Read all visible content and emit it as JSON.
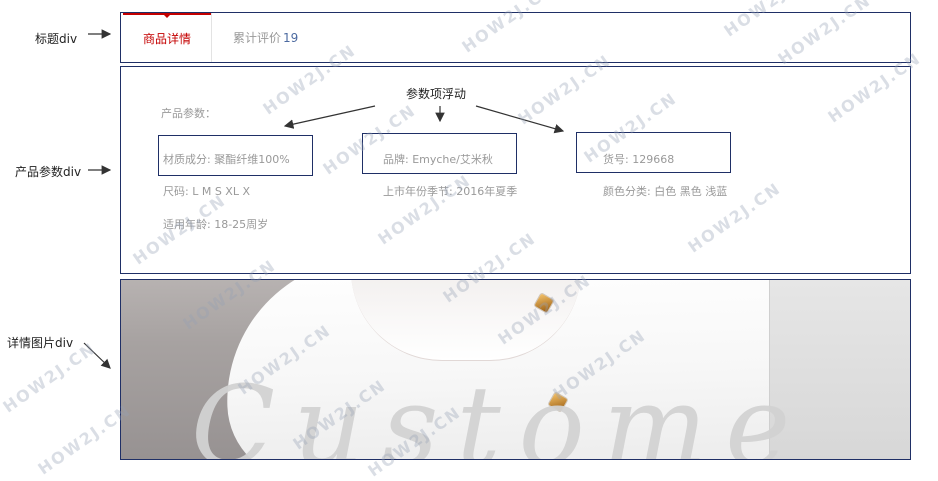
{
  "labels": {
    "title_div": "标题div",
    "params_div": "产品参数div",
    "detail_image_div": "详情图片div"
  },
  "tabs": {
    "active": "商品详情",
    "reviews_label": "累计评价",
    "reviews_count": "19"
  },
  "annotation": {
    "float_items": "参数项浮动"
  },
  "params": {
    "heading": "产品参数：",
    "items": [
      "材质成分: 聚酯纤维100%",
      "品牌: Emyche/艾米秋",
      "货号: 129668",
      "尺码: L M S XL X",
      "上市年份季节: 2016年夏季",
      "颜色分类: 白色 黑色 浅蓝",
      "适用年龄: 18-25周岁"
    ]
  },
  "photo": {
    "script_text": "Custome"
  },
  "watermark": {
    "text": "HOW2J.CN"
  }
}
